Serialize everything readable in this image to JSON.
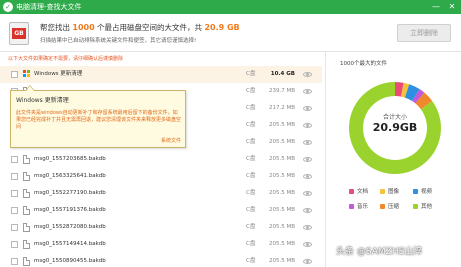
{
  "window": {
    "title": "电脑清理-查找大文件",
    "controls": [
      "—",
      "✕"
    ]
  },
  "header": {
    "icon_text": "GB",
    "headline_pre": "帮您找出",
    "count": "1000",
    "headline_mid": "个最占用磁盘空间的大文件，共",
    "total": "20.9 GB",
    "subline": "扫描结果中已自动排除系统关键文件和便签，其它请您谨慎选择!",
    "clean_button": "立即删除"
  },
  "warning": "以下大文件如果确定不需要，请仔细确认后谨慎删除",
  "tooltip": {
    "title": "Windows 更新清理",
    "body": "此文件夹是windows自动更新补丁和存留系统最用后留下的备份文件，如果您已经完成补丁并且无需再回退，建议您清理该文件夹来释放更多磁盘空间",
    "tag": "系统文件"
  },
  "rows": [
    {
      "name": "Windows 更新清理",
      "drive": "C盘",
      "size": "10.4 GB",
      "kind": "windows"
    },
    {
      "name": "",
      "drive": "C盘",
      "size": "239.7 MB",
      "kind": "file"
    },
    {
      "name": "",
      "drive": "C盘",
      "size": "217.2 MB",
      "kind": "file"
    },
    {
      "name": "",
      "drive": "C盘",
      "size": "205.5 MB",
      "kind": "file"
    },
    {
      "name": "",
      "drive": "C盘",
      "size": "205.5 MB",
      "kind": "file"
    },
    {
      "name": "msg0_1557203685.bakdb",
      "drive": "C盘",
      "size": "205.5 MB",
      "kind": "file"
    },
    {
      "name": "msg0_1563325641.bakdb",
      "drive": "C盘",
      "size": "205.5 MB",
      "kind": "file"
    },
    {
      "name": "msg0_1552277190.bakdb",
      "drive": "C盘",
      "size": "205.5 MB",
      "kind": "file"
    },
    {
      "name": "msg0_1557191376.bakdb",
      "drive": "C盘",
      "size": "205.5 MB",
      "kind": "file"
    },
    {
      "name": "msg0_1552872080.bakdb",
      "drive": "C盘",
      "size": "205.5 MB",
      "kind": "file"
    },
    {
      "name": "msg0_1557149414.bakdb",
      "drive": "C盘",
      "size": "205.5 MB",
      "kind": "file"
    },
    {
      "name": "msg0_1550890455.bakdb",
      "drive": "C盘",
      "size": "205.5 MB",
      "kind": "file"
    }
  ],
  "panel": {
    "title": "1000个最大的文件",
    "center_label": "合计大小",
    "center_value": "20.9GB"
  },
  "chart_data": {
    "type": "pie",
    "title": "1000个最大的文件",
    "categories": [
      "文档",
      "图像",
      "视频",
      "音乐",
      "压缩",
      "其他"
    ],
    "values": [
      3,
      2,
      4,
      2,
      4,
      85
    ],
    "colors": [
      "#e94d73",
      "#f5c23d",
      "#2f8fe0",
      "#c35ad9",
      "#ee8a2b",
      "#9bd32e"
    ]
  },
  "watermark": "头条 @SAMZHE山淬"
}
